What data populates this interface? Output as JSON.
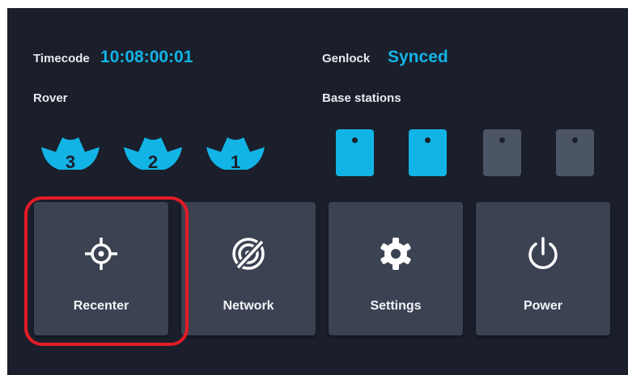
{
  "status": {
    "timecode_label": "Timecode",
    "timecode_value": "10:08:00:01",
    "genlock_label": "Genlock",
    "genlock_value": "Synced"
  },
  "rover": {
    "label": "Rover",
    "devices": [
      {
        "number": "3",
        "active": true
      },
      {
        "number": "2",
        "active": true
      },
      {
        "number": "1",
        "active": true
      }
    ]
  },
  "base_stations": {
    "label": "Base stations",
    "stations": [
      {
        "active": true
      },
      {
        "active": true
      },
      {
        "active": false
      },
      {
        "active": false
      }
    ]
  },
  "actions": [
    {
      "label": "Recenter",
      "icon": "crosshair-icon"
    },
    {
      "label": "Network",
      "icon": "network-off-icon"
    },
    {
      "label": "Settings",
      "icon": "gear-icon"
    },
    {
      "label": "Power",
      "icon": "power-icon"
    }
  ],
  "colors": {
    "background": "#1a1f2b",
    "accent": "#12b4e6",
    "tile": "#3b4252",
    "inactive_station": "#4c5565",
    "highlight": "#e31b25"
  }
}
